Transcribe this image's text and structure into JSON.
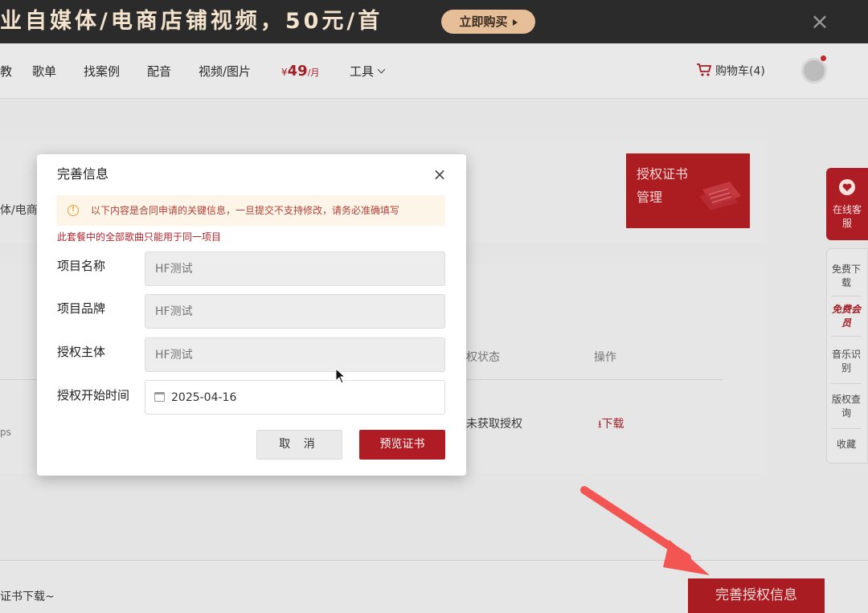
{
  "banner": {
    "text": "业自媒体/电商店铺视频，50元/首",
    "buy_label": "立即购买",
    "close_glyph": "×"
  },
  "nav": {
    "items": [
      "教",
      "歌单",
      "找案例",
      "配音",
      "视频/图片"
    ],
    "price": {
      "currency": "¥",
      "amount": "49",
      "unit": "/月"
    },
    "tools_label": "工具",
    "cart_label": "购物车(4)"
  },
  "page": {
    "cert_label_1": "授权证书",
    "cert_label_2": "管理",
    "partial_category": "体/电商",
    "table_header_status": "权状态",
    "table_header_action": "操作",
    "row_partial": "ps",
    "row_status": "未获取授权",
    "row_download": "下载",
    "bottom_text": "证书下载~",
    "complete_button": "完善授权信息"
  },
  "sidebar": {
    "online_service": "在线客服",
    "items": [
      "免费下载",
      "免费会员",
      "音乐识别",
      "版权查询",
      "收藏"
    ]
  },
  "modal": {
    "title": "完善信息",
    "close_glyph": "×",
    "warning": "以下内容是合同申请的关键信息，一旦提交不支持修改，请务必准确填写",
    "note": "此套餐中的全部歌曲只能用于同一项目",
    "fields": [
      {
        "label": "项目名称",
        "value": "HF测试"
      },
      {
        "label": "项目品牌",
        "value": "HF测试"
      },
      {
        "label": "授权主体",
        "value": "HF测试"
      },
      {
        "label": "授权开始时间",
        "value": "2025-04-16"
      }
    ],
    "cancel_label": "取 消",
    "preview_label": "预览证书"
  },
  "colors": {
    "brand_red": "#ad1d23",
    "banner_bg": "#2b2b2b",
    "gold": "#e6bf99"
  }
}
